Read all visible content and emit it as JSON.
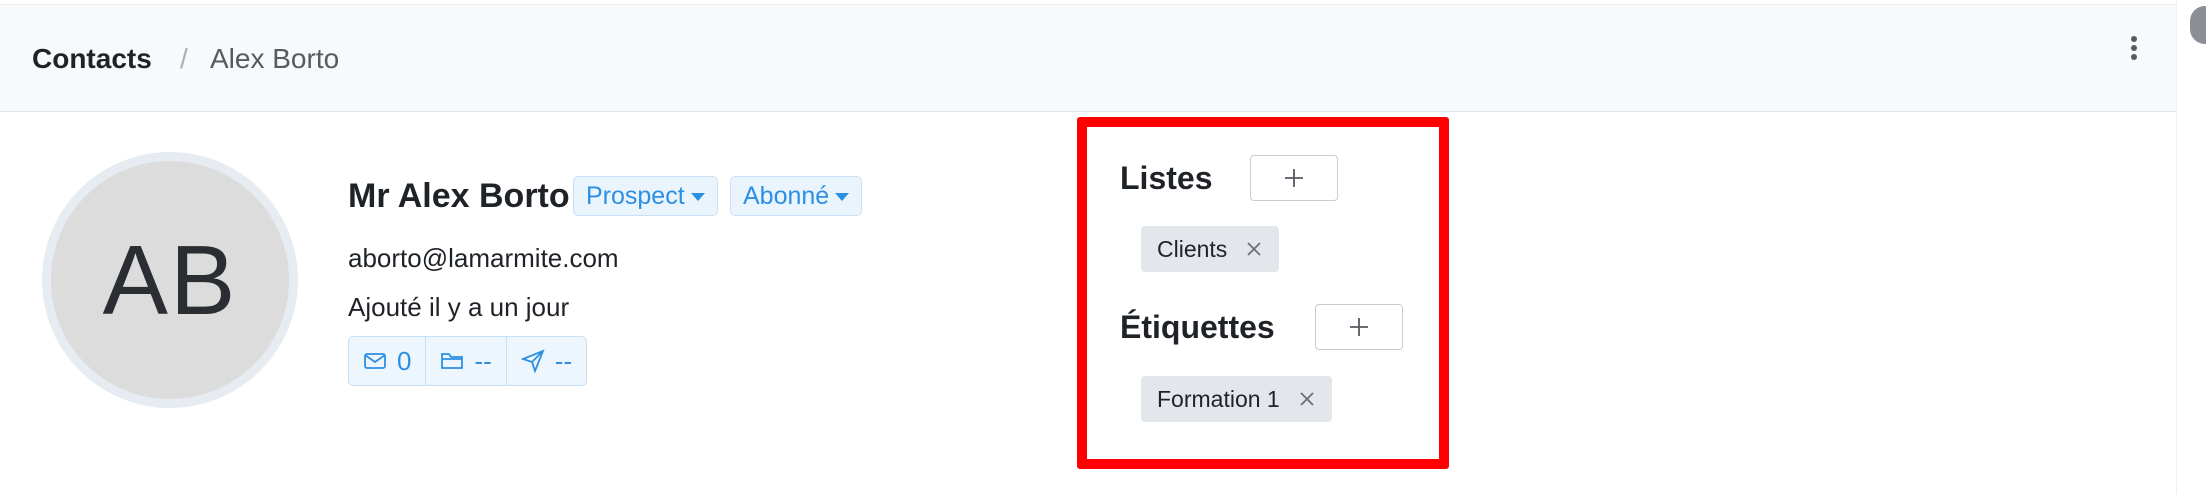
{
  "breadcrumb": {
    "root": "Contacts",
    "separator": "/",
    "current": "Alex Borto"
  },
  "contact": {
    "initials": "AB",
    "name": "Mr Alex Borto",
    "status_badge": "Prospect",
    "subscription_badge": "Abonné",
    "email": "aborto@lamarmite.com",
    "added": "Ajouté il y a un jour",
    "stats": {
      "messages": "0",
      "files": "--",
      "campaigns": "--"
    }
  },
  "lists": {
    "title": "Listes",
    "items": [
      "Clients"
    ]
  },
  "tags": {
    "title": "Étiquettes",
    "items": [
      "Formation 1"
    ]
  },
  "colors": {
    "accent": "#2d8fe3",
    "highlight": "#ff0000"
  },
  "icons": [
    "kebab-menu-icon",
    "mail-icon",
    "folder-icon",
    "send-icon",
    "plus-icon",
    "close-icon",
    "caret-down-icon"
  ]
}
